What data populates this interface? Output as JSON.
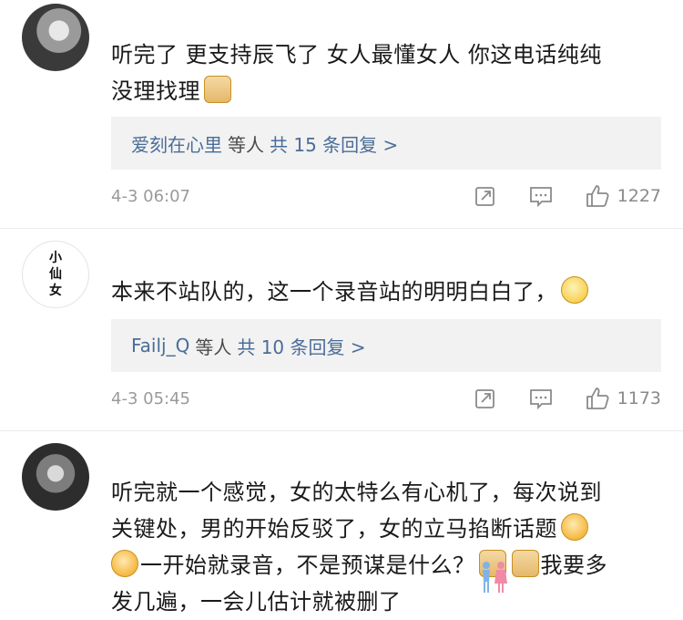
{
  "comments": [
    {
      "username": "",
      "text_line1": "听完了 更支持辰飞了 女人最懂女人 你这电话纯纯",
      "text_line2": "没理找理",
      "reply_summary": {
        "users": "爱刻在心里",
        "suffix": "等人",
        "count": "共 15 条回复 >"
      },
      "time": "4-3 06:07",
      "likes": "1227"
    },
    {
      "username": "",
      "avatar_text": [
        "小",
        "仙",
        "女"
      ],
      "text_line1": "本来不站队的，这一个录音站的明明白白了，",
      "reply_summary": {
        "users": "Failj_Q",
        "suffix": "等人",
        "count": "共 10 条回复 >"
      },
      "time": "4-3 05:45",
      "likes": "1173"
    },
    {
      "username": "",
      "text_line1": "听完就一个感觉，女的太特么有心机了，每次说到",
      "text_line2": "关键处，男的开始反驳了，女的立马掐断话题",
      "text_line3a": "一开始就录音，不是预谋是什么？",
      "text_line3b": "我要多",
      "text_line4": "发几遍，一会儿估计就被删了"
    }
  ],
  "icons": {
    "repost": "repost-icon",
    "comment": "comment-icon",
    "like": "thumbs-up-icon",
    "doge": "doge-emoji",
    "smile": "smile-emoji",
    "cry": "crying-emoji"
  },
  "colors": {
    "link": "#4a6d99",
    "meta": "#9a9a9a",
    "reply_bg": "#f2f2f2"
  }
}
